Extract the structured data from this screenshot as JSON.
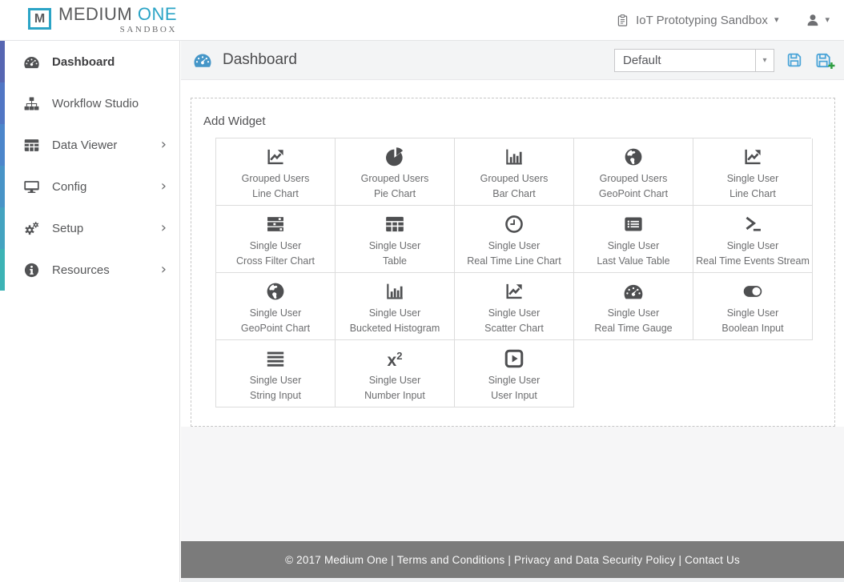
{
  "brand": {
    "initial": "M",
    "name": "MEDIUM ",
    "accent": "ONE",
    "tagline": "SANDBOX"
  },
  "topbar": {
    "workspace_label": "IoT Prototyping Sandbox"
  },
  "sidebar": {
    "items": [
      {
        "label": "Dashboard",
        "icon": "gauge",
        "active": true,
        "has_chevron": false,
        "strip_color": "#5766b2"
      },
      {
        "label": "Workflow Studio",
        "icon": "sitemap",
        "active": false,
        "has_chevron": false,
        "strip_color": "#5176c4"
      },
      {
        "label": "Data Viewer",
        "icon": "table",
        "active": false,
        "has_chevron": true,
        "strip_color": "#4c86cb"
      },
      {
        "label": "Config",
        "icon": "desktop",
        "active": false,
        "has_chevron": true,
        "strip_color": "#4894c7"
      },
      {
        "label": "Setup",
        "icon": "gears",
        "active": false,
        "has_chevron": true,
        "strip_color": "#44a3c0"
      },
      {
        "label": "Resources",
        "icon": "info",
        "active": false,
        "has_chevron": true,
        "strip_color": "#3db3b5"
      }
    ]
  },
  "page_header": {
    "title": "Dashboard",
    "view_select_value": "Default"
  },
  "panel": {
    "title": "Add Widget",
    "widgets": [
      {
        "group": "Grouped Users",
        "type": "Line Chart",
        "icon": "line-chart"
      },
      {
        "group": "Grouped Users",
        "type": "Pie Chart",
        "icon": "pie-chart"
      },
      {
        "group": "Grouped Users",
        "type": "Bar Chart",
        "icon": "bar-chart"
      },
      {
        "group": "Grouped Users",
        "type": "GeoPoint Chart",
        "icon": "globe"
      },
      {
        "group": "Single User",
        "type": "Line Chart",
        "icon": "line-chart"
      },
      {
        "group": "Single User",
        "type": "Cross Filter Chart",
        "icon": "tasks"
      },
      {
        "group": "Single User",
        "type": "Table",
        "icon": "table"
      },
      {
        "group": "Single User",
        "type": "Real Time Line Chart",
        "icon": "clock"
      },
      {
        "group": "Single User",
        "type": "Last Value Table",
        "icon": "list-alt"
      },
      {
        "group": "Single User",
        "type": "Real Time Events Stream",
        "icon": "terminal"
      },
      {
        "group": "Single User",
        "type": "GeoPoint Chart",
        "icon": "globe"
      },
      {
        "group": "Single User",
        "type": "Bucketed Histogram",
        "icon": "bar-chart"
      },
      {
        "group": "Single User",
        "type": "Scatter Chart",
        "icon": "line-chart"
      },
      {
        "group": "Single User",
        "type": "Real Time Gauge",
        "icon": "gauge"
      },
      {
        "group": "Single User",
        "type": "Boolean Input",
        "icon": "toggle-on"
      },
      {
        "group": "Single User",
        "type": "String Input",
        "icon": "justify"
      },
      {
        "group": "Single User",
        "type": "Number Input",
        "icon": "x2"
      },
      {
        "group": "Single User",
        "type": "User Input",
        "icon": "play-square"
      }
    ]
  },
  "footer": {
    "copyright": "© 2017 Medium One",
    "separator": " | ",
    "links": [
      "Terms and Conditions",
      "Privacy and Data Security Policy",
      "Contact Us"
    ]
  },
  "colors": {
    "brand_teal": "#2ba4c6",
    "header_icon_blue": "#4596c8",
    "save_blue": "#4aa4d8",
    "plus_green": "#2f9e41",
    "footer_bg": "#7b7b7b"
  }
}
